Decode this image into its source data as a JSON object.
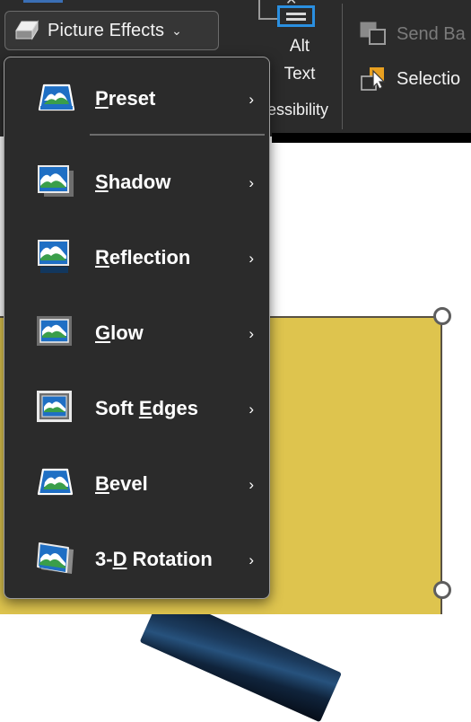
{
  "app": {
    "theme": "dark",
    "accent_blue": "#2a8fe0",
    "menu_bg": "#2b2b2b",
    "shape_fill": "#dec44e",
    "shape_outline": "#595243",
    "disabled_text": "#7b7b7b"
  },
  "ribbon": {
    "picture_effects": {
      "label": "Picture Effects",
      "icon": "cube-icon",
      "chevron": "chevron-down-icon",
      "chevron_glyph": "⌄"
    },
    "alt_text": {
      "icon": "alt-text-icon",
      "line1": "Alt",
      "line2": "Text",
      "line3": "essibility"
    },
    "arrange": {
      "send_back": {
        "label": "Send Ba",
        "icon": "send-backward-icon",
        "disabled": true
      },
      "selection": {
        "label": "Selectio",
        "icon": "selection-pane-icon",
        "disabled": false
      }
    }
  },
  "menu": {
    "name": "Picture Effects menu",
    "items": [
      {
        "id": "preset",
        "label_pre": "",
        "label_key": "P",
        "label_post": "reset",
        "icon": "picture-preset-icon",
        "arrow": "›",
        "has_submenu": true
      },
      {
        "id": "shadow",
        "label_pre": "",
        "label_key": "S",
        "label_post": "hadow",
        "icon": "picture-shadow-icon",
        "arrow": "›",
        "has_submenu": true
      },
      {
        "id": "reflection",
        "label_pre": "",
        "label_key": "R",
        "label_post": "eflection",
        "icon": "picture-reflection-icon",
        "arrow": "›",
        "has_submenu": true
      },
      {
        "id": "glow",
        "label_pre": "",
        "label_key": "G",
        "label_post": "low",
        "icon": "picture-glow-icon",
        "arrow": "›",
        "has_submenu": true
      },
      {
        "id": "soft-edges",
        "label_pre": "Soft ",
        "label_key": "E",
        "label_post": "dges",
        "icon": "picture-soft-edges-icon",
        "arrow": "›",
        "has_submenu": true
      },
      {
        "id": "bevel",
        "label_pre": "",
        "label_key": "B",
        "label_post": "evel",
        "icon": "picture-bevel-icon",
        "arrow": "›",
        "has_submenu": true
      },
      {
        "id": "3d-rotation",
        "label_pre": "3-",
        "label_key": "D",
        "label_post": " Rotation",
        "icon": "picture-3d-rotation-icon",
        "arrow": "›",
        "has_submenu": true
      }
    ]
  },
  "canvas": {
    "shape": {
      "name": "yellow-rectangle",
      "fill": "#dec44e",
      "selected": true,
      "handles": [
        "top-right",
        "bottom-right"
      ]
    },
    "pen_object": {
      "name": "pen-image",
      "color": "#1b3a5c"
    }
  }
}
